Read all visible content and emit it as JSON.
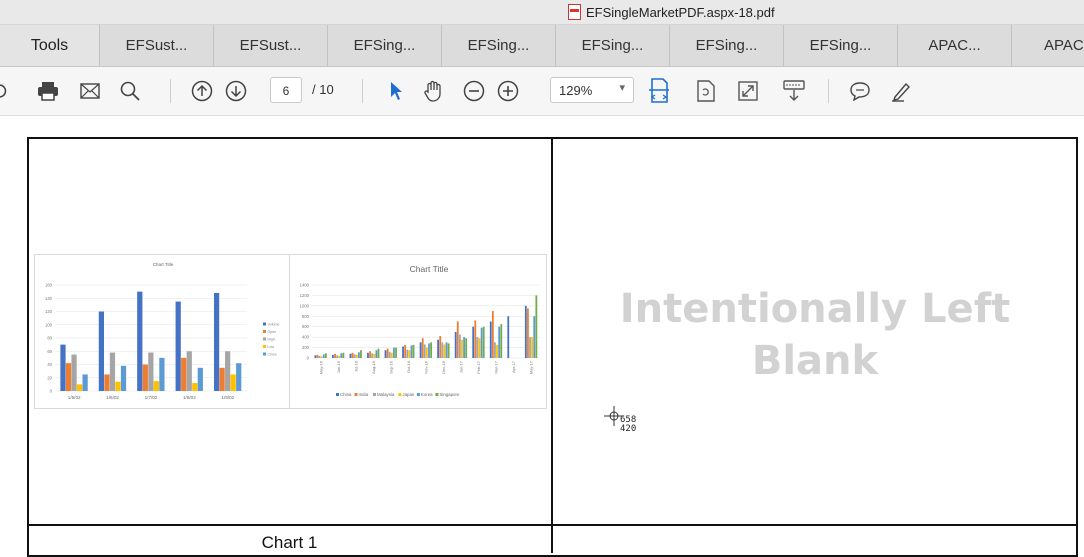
{
  "window": {
    "title": "EFSingleMarketPDF.aspx-18.pdf"
  },
  "tabs": [
    {
      "label": "Tools"
    },
    {
      "label": "EFSust..."
    },
    {
      "label": "EFSust..."
    },
    {
      "label": "EFSing..."
    },
    {
      "label": "EFSing..."
    },
    {
      "label": "EFSing..."
    },
    {
      "label": "EFSing..."
    },
    {
      "label": "EFSing..."
    },
    {
      "label": "APAC..."
    },
    {
      "label": "APAC"
    }
  ],
  "toolbar": {
    "page_current": "6",
    "page_total": "/ 10",
    "zoom": "129%",
    "icons": [
      "back-icon",
      "print-icon",
      "email-icon",
      "search-icon",
      "prev-page-icon",
      "next-page-icon",
      "select-arrow-icon",
      "hand-icon",
      "zoom-out-icon",
      "zoom-in-icon",
      "fit-width-icon",
      "rotate-icon",
      "fullscreen-icon",
      "read-mode-icon",
      "comment-icon",
      "highlight-pen-icon"
    ]
  },
  "document": {
    "right_cell_text_line1": "Intentionally Left",
    "right_cell_text_line2": "Blank",
    "caption_left": "Chart 1",
    "cursor_x": "658",
    "cursor_y": "420"
  },
  "chart_data": [
    {
      "type": "bar",
      "title": "Chart Title",
      "categories": [
        "1/5/02",
        "1/6/02",
        "1/7/02",
        "1/8/02",
        "1/9/02"
      ],
      "ylim": [
        0,
        160
      ],
      "yticks": [
        "0",
        "20",
        "40",
        "60",
        "80",
        "100",
        "120",
        "140",
        "160"
      ],
      "series": [
        {
          "name": "Volume",
          "color": "#4472c4",
          "values": [
            70,
            120,
            150,
            135,
            148
          ]
        },
        {
          "name": "Open",
          "color": "#ed7d31",
          "values": [
            42,
            25,
            40,
            50,
            35
          ]
        },
        {
          "name": "High",
          "color": "#a5a5a5",
          "values": [
            55,
            58,
            58,
            60,
            60
          ]
        },
        {
          "name": "Low",
          "color": "#ffc000",
          "values": [
            10,
            14,
            15,
            12,
            25
          ]
        },
        {
          "name": "Close",
          "color": "#5b9bd5",
          "values": [
            25,
            38,
            50,
            35,
            42
          ]
        }
      ],
      "legend": "right"
    },
    {
      "type": "bar",
      "title": "Chart Title",
      "categories": [
        "May-16",
        "Jun-16",
        "Jul-16",
        "Aug-16",
        "Sep-16",
        "Oct-16",
        "Nov-16",
        "Dec-16",
        "Jan-17",
        "Feb-17",
        "Mar-17",
        "Apr-17",
        "May-17"
      ],
      "ylim": [
        0,
        1400
      ],
      "yticks": [
        "0",
        "200",
        "400",
        "600",
        "800",
        "1000",
        "1200",
        "1400"
      ],
      "series": [
        {
          "name": "China",
          "color": "#4472c4",
          "values": [
            50,
            60,
            80,
            100,
            150,
            220,
            300,
            350,
            500,
            600,
            700,
            800,
            1000
          ]
        },
        {
          "name": "India",
          "color": "#ed7d31",
          "values": [
            60,
            80,
            100,
            130,
            180,
            250,
            380,
            420,
            700,
            720,
            900,
            0,
            950
          ]
        },
        {
          "name": "Malaysia",
          "color": "#a5a5a5",
          "values": [
            40,
            50,
            70,
            90,
            120,
            160,
            260,
            300,
            450,
            400,
            300,
            0,
            400
          ]
        },
        {
          "name": "Japan",
          "color": "#ffc000",
          "values": [
            30,
            40,
            60,
            80,
            100,
            150,
            200,
            260,
            350,
            380,
            250,
            0,
            400
          ]
        },
        {
          "name": "Korea",
          "color": "#5b9bd5",
          "values": [
            70,
            90,
            110,
            150,
            200,
            240,
            280,
            300,
            400,
            580,
            600,
            0,
            800
          ]
        },
        {
          "name": "Singapore",
          "color": "#70ad47",
          "values": [
            90,
            100,
            150,
            180,
            200,
            250,
            300,
            280,
            380,
            600,
            650,
            0,
            1200
          ]
        }
      ],
      "legend": "bottom"
    }
  ]
}
